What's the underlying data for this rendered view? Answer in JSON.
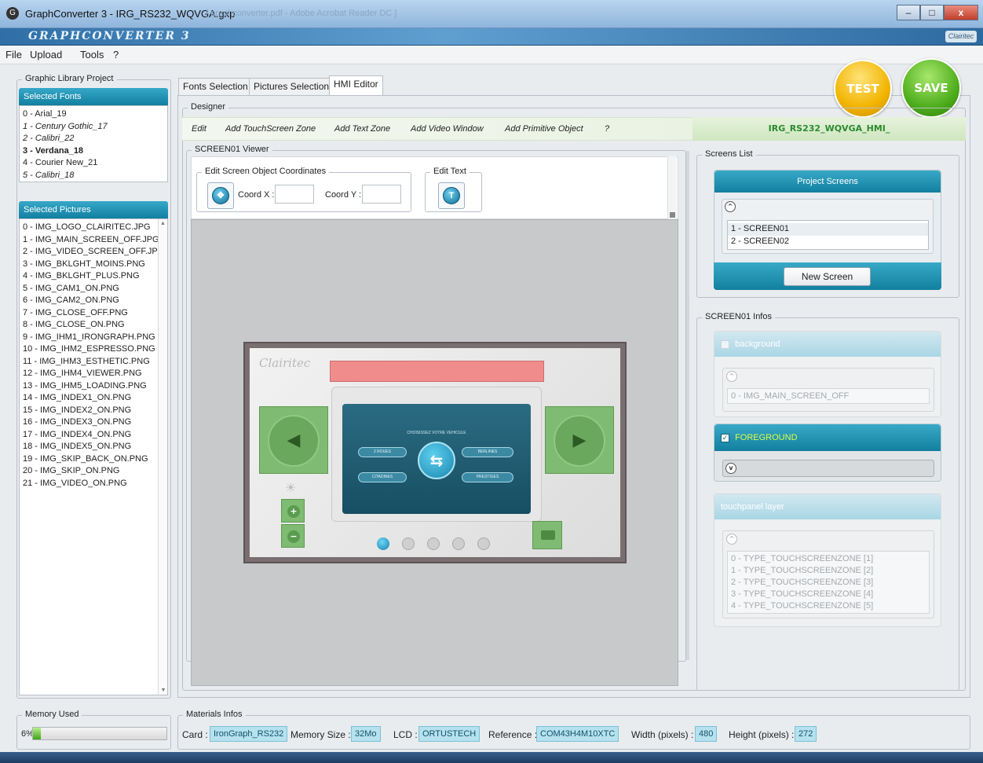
{
  "window": {
    "title": "GraphConverter 3 - IRG_RS232_WQVGA.gxp",
    "title_trail": "[ graphconverter.pdf - Adobe Acrobat Reader DC ]",
    "app_logo": "GRAPHCONVERTER 3",
    "brand": "Clairitec",
    "minimize": "–",
    "maximize": "□",
    "close": "x"
  },
  "menu": [
    "File",
    "Upload",
    "Tools",
    "?"
  ],
  "left_panel": {
    "title": "Graphic Library Project",
    "fonts_header": "Selected Fonts",
    "fonts": [
      {
        "label": "0 - Arial_19",
        "style": "normal"
      },
      {
        "label": "1 - Century Gothic_17",
        "style": "italic"
      },
      {
        "label": "2 - Calibri_22",
        "style": "italic"
      },
      {
        "label": "3 - Verdana_18",
        "style": "bold"
      },
      {
        "label": "4 - Courier New_21",
        "style": "normal"
      },
      {
        "label": "5 - Calibri_18",
        "style": "italic"
      }
    ],
    "pictures_header": "Selected Pictures",
    "pictures": [
      "0 - IMG_LOGO_CLAIRITEC.JPG",
      "1 - IMG_MAIN_SCREEN_OFF.JPG",
      "2 - IMG_VIDEO_SCREEN_OFF.JPG",
      "3 - IMG_BKLGHT_MOINS.PNG",
      "4 - IMG_BKLGHT_PLUS.PNG",
      "5 - IMG_CAM1_ON.PNG",
      "6 - IMG_CAM2_ON.PNG",
      "7 - IMG_CLOSE_OFF.PNG",
      "8 - IMG_CLOSE_ON.PNG",
      "9 - IMG_IHM1_IRONGRAPH.PNG",
      "10 - IMG_IHM2_ESPRESSO.PNG",
      "11 - IMG_IHM3_ESTHETIC.PNG",
      "12 - IMG_IHM4_VIEWER.PNG",
      "13 - IMG_IHM5_LOADING.PNG",
      "14 - IMG_INDEX1_ON.PNG",
      "15 - IMG_INDEX2_ON.PNG",
      "16 - IMG_INDEX3_ON.PNG",
      "17 - IMG_INDEX4_ON.PNG",
      "18 - IMG_INDEX5_ON.PNG",
      "19 - IMG_SKIP_BACK_ON.PNG",
      "20 - IMG_SKIP_ON.PNG",
      "21 - IMG_VIDEO_ON.PNG"
    ]
  },
  "tabs": [
    "Fonts Selection",
    "Pictures Selection",
    "HMI Editor"
  ],
  "actions": {
    "test": "TEST",
    "save": "SAVE"
  },
  "designer": {
    "title": "Designer",
    "toolbar": [
      "Edit",
      "Add TouchScreen Zone",
      "Add Text Zone",
      "Add Video Window",
      "Add Primitive Object",
      "?"
    ],
    "file_title": "IRG_RS232_WQVGA_HMI_"
  },
  "viewer": {
    "title": "SCREEN01 Viewer",
    "coords_group": "Edit Screen Object Coordinates",
    "coord_x_label": "Coord X :",
    "coord_y_label": "Coord Y :",
    "coord_x": "",
    "coord_y": "",
    "edit_text_group": "Edit Text",
    "preview": {
      "logo": "Clairitec",
      "heading": "CHOISISSEZ VOTRE VEHICULE",
      "options": [
        "2 ROUES",
        "BERLINES",
        "CITADINES",
        "PRESTIGES"
      ]
    }
  },
  "screens_list": {
    "title": "Screens List",
    "header": "Project Screens",
    "items": [
      "1 - SCREEN01",
      "2 - SCREEN02"
    ],
    "new_button": "New Screen"
  },
  "infos": {
    "title": "SCREEN01 Infos",
    "background_label": "background",
    "background_value": "0 - IMG_MAIN_SCREEN_OFF",
    "foreground_label": "FOREGROUND",
    "touch_label": "touchpanel layer",
    "touch_items": [
      "0 - TYPE_TOUCHSCREENZONE [1]",
      "1 - TYPE_TOUCHSCREENZONE [2]",
      "2 - TYPE_TOUCHSCREENZONE [3]",
      "3 - TYPE_TOUCHSCREENZONE [4]",
      "4 - TYPE_TOUCHSCREENZONE [5]"
    ]
  },
  "memory": {
    "title": "Memory Used",
    "percent_label": "6%",
    "fraction": 0.06
  },
  "materials": {
    "title": "Materials Infos",
    "card_label": "Card :",
    "card": "IronGraph_RS232",
    "memsize_label": "Memory Size :",
    "memsize": "32Mo",
    "lcd_label": "LCD :",
    "lcd": "ORTUSTECH",
    "ref_label": "Reference :",
    "ref": "COM43H4M10XTC",
    "width_label": "Width (pixels) :",
    "width": "480",
    "height_label": "Height (pixels) :",
    "height": "272"
  },
  "colors": {
    "teal": "#127f9f",
    "green_title": "#2b8a2f",
    "test": "#f2b400",
    "save": "#4fae1c"
  }
}
